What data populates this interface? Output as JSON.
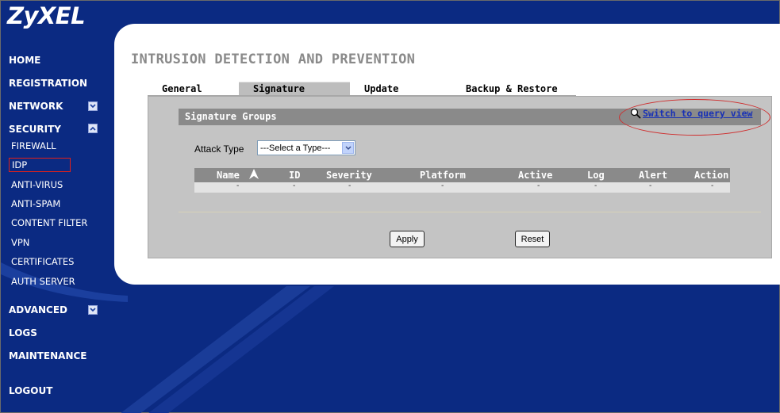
{
  "brand": {
    "logo": "ZyXEL"
  },
  "page": {
    "title": "INTRUSION DETECTION AND PREVENTION"
  },
  "nav": {
    "items": [
      {
        "label": "HOME"
      },
      {
        "label": "REGISTRATION"
      },
      {
        "label": "NETWORK",
        "toggle": "expand"
      },
      {
        "label": "SECURITY",
        "toggle": "collapse"
      },
      {
        "label": "ADVANCED",
        "toggle": "expand"
      },
      {
        "label": "LOGS"
      },
      {
        "label": "MAINTENANCE"
      },
      {
        "label": "LOGOUT"
      }
    ],
    "security_sub": [
      "FIREWALL",
      "IDP",
      "ANTI-VIRUS",
      "ANTI-SPAM",
      "CONTENT FILTER",
      "VPN",
      "CERTIFICATES",
      "AUTH SERVER"
    ],
    "active_sub": "IDP"
  },
  "tabs": [
    {
      "label": "General"
    },
    {
      "label": "Signature",
      "selected": true
    },
    {
      "label": "Update"
    },
    {
      "label": "Backup & Restore"
    }
  ],
  "section": {
    "title": "Signature Groups",
    "query_link": "Switch to query view",
    "attack_type_label": "Attack Type",
    "attack_type_value": "---Select a Type---"
  },
  "table": {
    "headers": [
      "Name",
      "ID",
      "Severity",
      "Platform",
      "Active",
      "Log",
      "Alert",
      "Action"
    ],
    "row": [
      "-",
      "-",
      "-",
      "-",
      "-",
      "-",
      "-",
      "-"
    ]
  },
  "buttons": {
    "apply": "Apply",
    "reset": "Reset"
  },
  "colors": {
    "background": "#0b2a82",
    "panel": "#ffffff",
    "section": "#c4c4c4",
    "header_bar": "#8a8a8a",
    "highlight": "#e0201a",
    "link": "#1730b6"
  }
}
